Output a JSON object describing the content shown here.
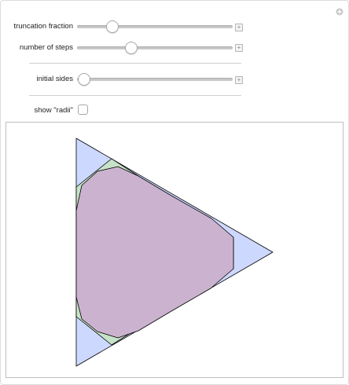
{
  "controls": {
    "truncation_fraction": {
      "label": "truncation fraction",
      "value": 0.18
    },
    "number_of_steps": {
      "label": "number of steps",
      "value": 0.35
    },
    "initial_sides": {
      "label": "initial sides",
      "value": 0.0
    },
    "show_radii": {
      "label": "show \"radii\"",
      "checked": false
    }
  },
  "icons": {
    "settings": "plus-circle-icon",
    "expand": "plus-box-icon"
  },
  "colors": {
    "corner_fill": "#cdd8ff",
    "edge_fill": "#c6e3c8",
    "inner_fill": "#cbb3cf",
    "stroke": "#000000"
  }
}
